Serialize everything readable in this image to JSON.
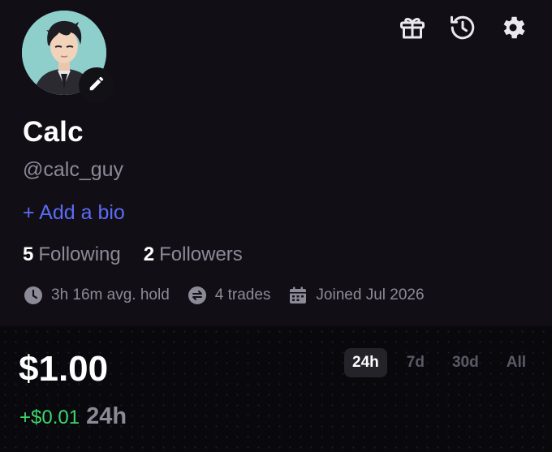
{
  "profile": {
    "display_name": "Calc",
    "handle": "@calc_guy",
    "add_bio_label": "+ Add a bio",
    "following_count": "5",
    "following_label": "Following",
    "followers_count": "2",
    "followers_label": "Followers",
    "stats": {
      "avg_hold": "3h 16m avg. hold",
      "trades": "4 trades",
      "joined": "Joined Jul 2026"
    }
  },
  "header_icons": [
    "gift-icon",
    "history-icon",
    "gear-icon"
  ],
  "balance": {
    "amount": "$1.00",
    "change": "+$0.01",
    "change_period": "24h"
  },
  "range_tabs": [
    {
      "label": "24h",
      "active": true
    },
    {
      "label": "7d",
      "active": false
    },
    {
      "label": "30d",
      "active": false
    },
    {
      "label": "All",
      "active": false
    }
  ],
  "colors": {
    "accent_blue": "#5b6cf6",
    "positive_green": "#3ed66b",
    "muted_text": "#8d8a97",
    "background": "#110f15"
  }
}
